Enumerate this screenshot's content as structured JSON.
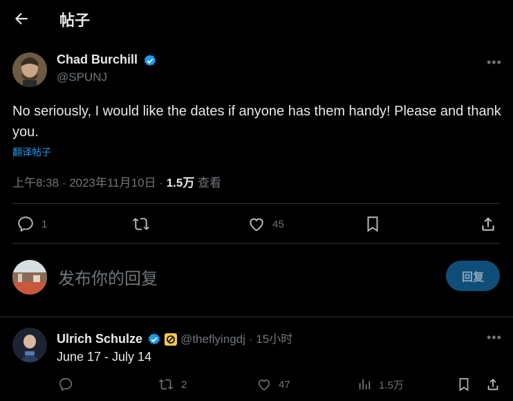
{
  "header": {
    "title": "帖子"
  },
  "post": {
    "author_name": "Chad Burchill",
    "author_handle": "@SPUNJ",
    "text": "No seriously, I would like the dates if anyone has them handy! Please and thank you.",
    "translate_label": "翻译帖子",
    "time": "上午8:38 · 2023年11月10日 · ",
    "views": "1.5万",
    "views_label": " 查看",
    "actions": {
      "replies": "1",
      "reposts": "",
      "likes": "45"
    }
  },
  "reply_box": {
    "placeholder": "发布你的回复",
    "button_label": "回复"
  },
  "reply": {
    "author_name": "Ulrich Schulze",
    "author_handle": "@theflyingdj",
    "time": "· 15小时",
    "text": "June 17 - July 14",
    "actions": {
      "replies": "",
      "reposts": "2",
      "likes": "47",
      "views": "1.5万"
    }
  },
  "colors": {
    "accent": "#1d9bf0",
    "background": "#000000",
    "divider": "#2f3336",
    "muted": "#71767b"
  }
}
